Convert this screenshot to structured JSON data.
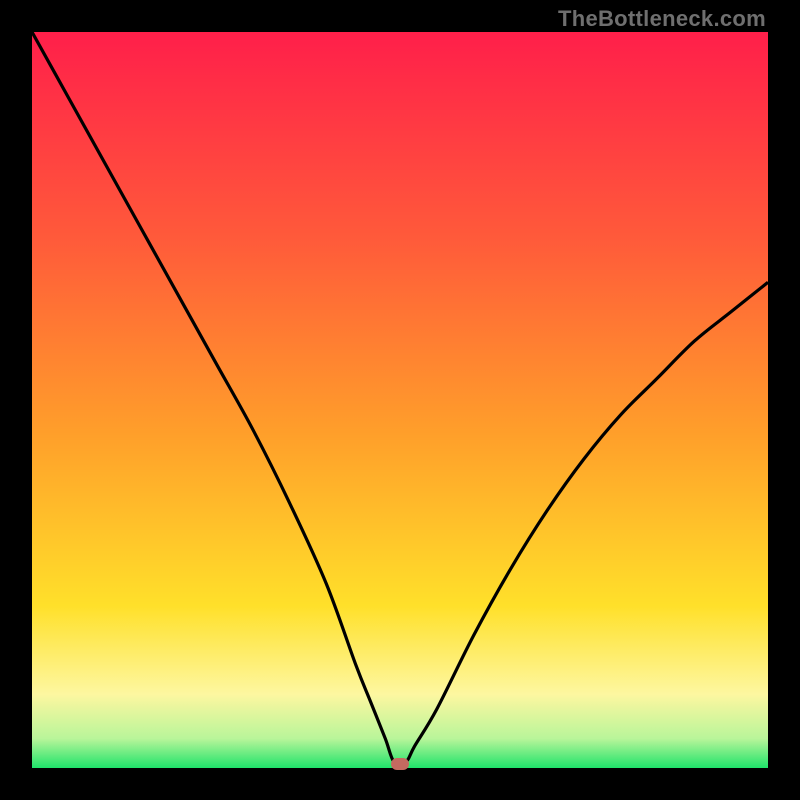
{
  "watermark": "TheBottleneck.com",
  "colors": {
    "gradient": [
      "#ff1f4a",
      "#ff5a3a",
      "#ffa02a",
      "#ffe02a",
      "#fdf7a0",
      "#b9f59a",
      "#1fe36a"
    ],
    "curve_stroke": "#000000",
    "marker_fill": "#c46a60"
  },
  "chart_data": {
    "type": "line",
    "title": "",
    "xlabel": "",
    "ylabel": "",
    "xlim": [
      0,
      100
    ],
    "ylim": [
      0,
      100
    ],
    "series": [
      {
        "name": "bottleneck-curve",
        "x": [
          0,
          5,
          10,
          15,
          20,
          25,
          30,
          35,
          40,
          44,
          46,
          48,
          49.2,
          50.8,
          52,
          55,
          60,
          65,
          70,
          75,
          80,
          85,
          90,
          95,
          100
        ],
        "y": [
          100,
          91,
          82,
          73,
          64,
          55,
          46,
          36,
          25,
          14,
          9,
          4,
          0.8,
          0.8,
          3,
          8,
          18,
          27,
          35,
          42,
          48,
          53,
          58,
          62,
          66
        ]
      }
    ],
    "minimum_marker": {
      "x": 50,
      "y": 0.6
    },
    "grid": false,
    "legend": false
  }
}
